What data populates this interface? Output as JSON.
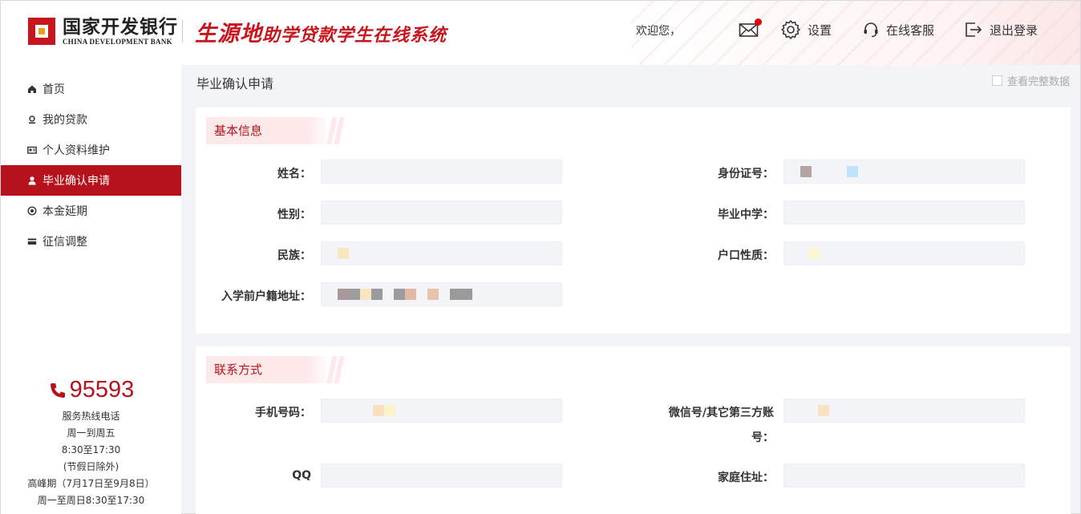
{
  "header": {
    "bank_name_cn": "国家开发银行",
    "bank_name_en": "CHINA DEVELOPMENT BANK",
    "system_title_big": "生源地",
    "system_title_rest": "助学贷款学生在线系统",
    "welcome": "欢迎您，",
    "settings_label": "设置",
    "service_label": "在线客服",
    "logout_label": "退出登录",
    "colors": {
      "brand": "#c8161e",
      "accent": "#b5121b"
    }
  },
  "sidebar": {
    "items": [
      {
        "label": "首页",
        "icon": "home-icon",
        "active": false
      },
      {
        "label": "我的贷款",
        "icon": "loan-icon",
        "active": false
      },
      {
        "label": "个人资料维护",
        "icon": "id-card-icon",
        "active": false
      },
      {
        "label": "毕业确认申请",
        "icon": "user-icon",
        "active": true
      },
      {
        "label": "本金延期",
        "icon": "at-icon",
        "active": false
      },
      {
        "label": "征信调整",
        "icon": "card-icon",
        "active": false
      }
    ],
    "hotline": {
      "number": "95593",
      "lines": [
        "服务热线电话",
        "周一到周五",
        "8:30至17:30",
        "(节假日除外)",
        "高峰期（7月17日至9月8日）",
        "周一至周日8:30至17:30"
      ]
    }
  },
  "main": {
    "page_title": "毕业确认申请",
    "view_all_label": "查看完整数据",
    "basic": {
      "title": "基本信息",
      "fields": {
        "name": "姓名：",
        "id_number": "身份证号：",
        "gender": "性别：",
        "high_school": "毕业中学：",
        "ethnicity": "民族：",
        "hukou_type": "户口性质：",
        "address": "入学前户籍地址："
      }
    },
    "contact": {
      "title": "联系方式",
      "fields": {
        "phone": "手机号码：",
        "wechat_line1": "微信号/其它第三方账",
        "wechat_line2": "号：",
        "qq": "QQ",
        "home_address": "家庭住址："
      }
    }
  }
}
